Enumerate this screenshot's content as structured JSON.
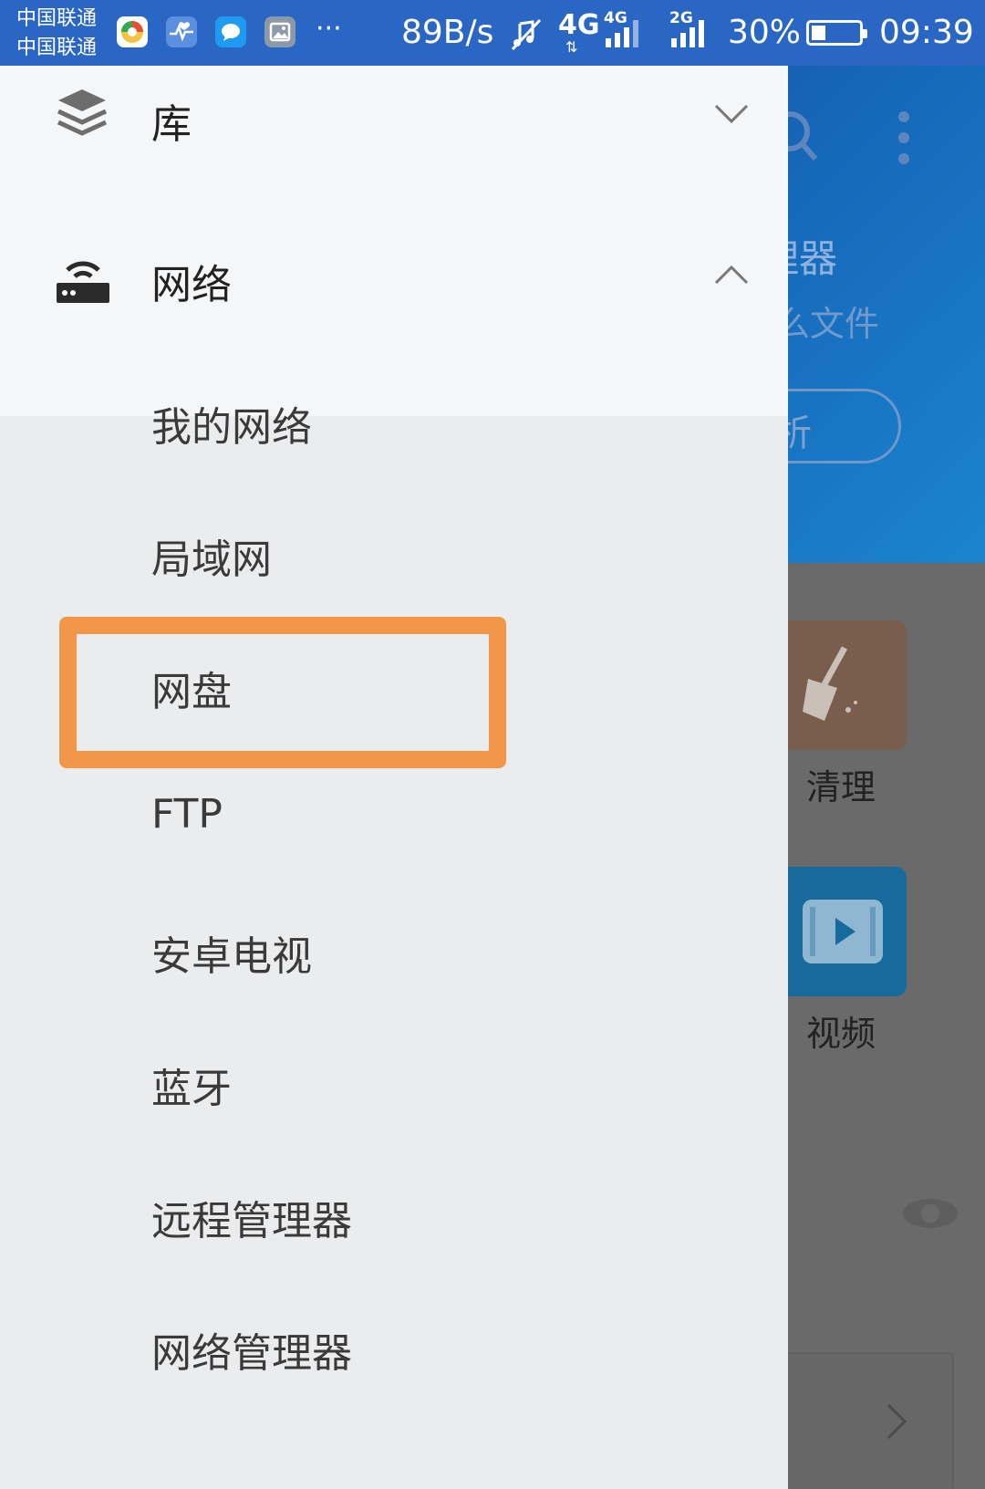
{
  "status_bar": {
    "carrier_1": "中国联通",
    "carrier_2": "中国联通",
    "net_speed": "89B/s",
    "net_1_label": "4G",
    "net_2_label": "4G",
    "net_3_label": "2G",
    "battery_text": "30%",
    "battery_level": 0.3,
    "time": "09:39",
    "more_glyph": "···"
  },
  "drawer": {
    "library": {
      "title": "库"
    },
    "network": {
      "title": "网络",
      "items": [
        "我的网络",
        "局域网",
        "网盘",
        "FTP",
        "安卓电视",
        "蓝牙",
        "远程管理器",
        "网络管理器"
      ]
    }
  },
  "background_app": {
    "title_partial": "理器",
    "subtitle_partial": "么文件",
    "pill_partial": "析",
    "tile_1_label": "清理",
    "tile_2_label": "视频"
  },
  "colors": {
    "status_bar": "#2a67c4",
    "highlight": "#f2974a",
    "drawer_bg": "#ebecee",
    "section_bg": "#f5f6f8"
  }
}
